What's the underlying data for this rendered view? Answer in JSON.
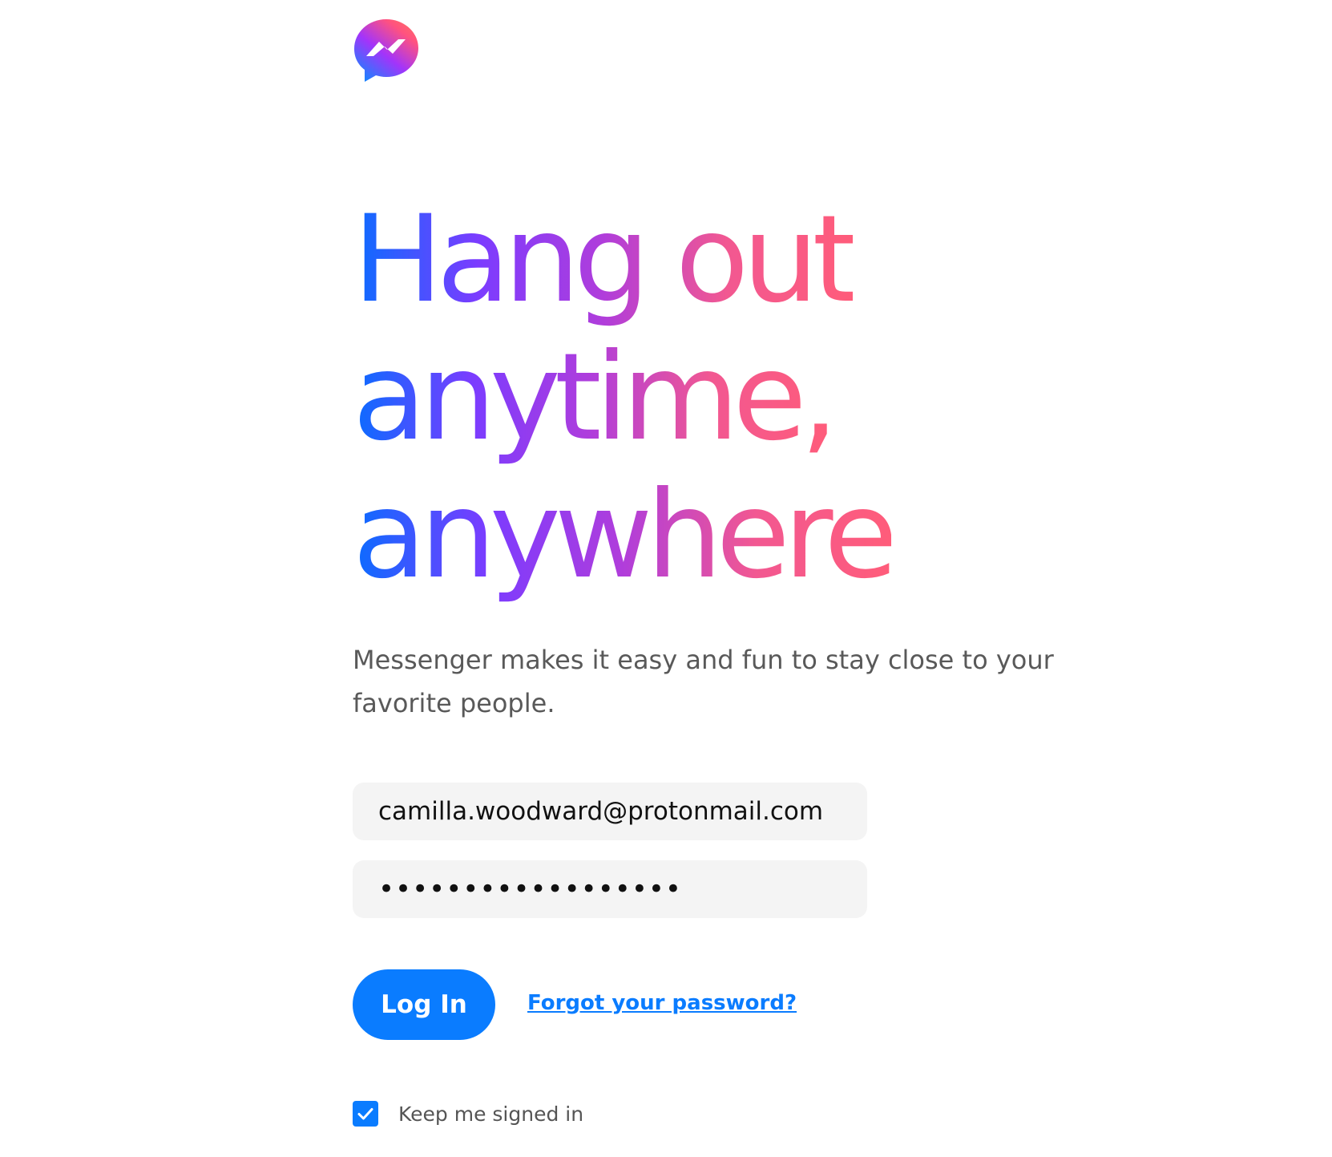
{
  "brand": {
    "logo_icon": "messenger-logo-icon",
    "gradient_colors": [
      "#0a6cff",
      "#7b3cff",
      "#b03ddb",
      "#f25891",
      "#ff5c7a"
    ]
  },
  "hero": {
    "headline_lines": [
      "Hang out",
      "anytime,",
      "anywhere"
    ],
    "tagline": "Messenger makes it easy and fun to stay close to your favorite people."
  },
  "login_form": {
    "email_value": "camilla.woodward@protonmail.com",
    "password_value": "••••••••••••••••••",
    "login_label": "Log In",
    "forgot_label": "Forgot your password?",
    "keep_signed_in_label": "Keep me signed in",
    "keep_signed_in_checked": true,
    "accent_color": "#0a7cff"
  }
}
